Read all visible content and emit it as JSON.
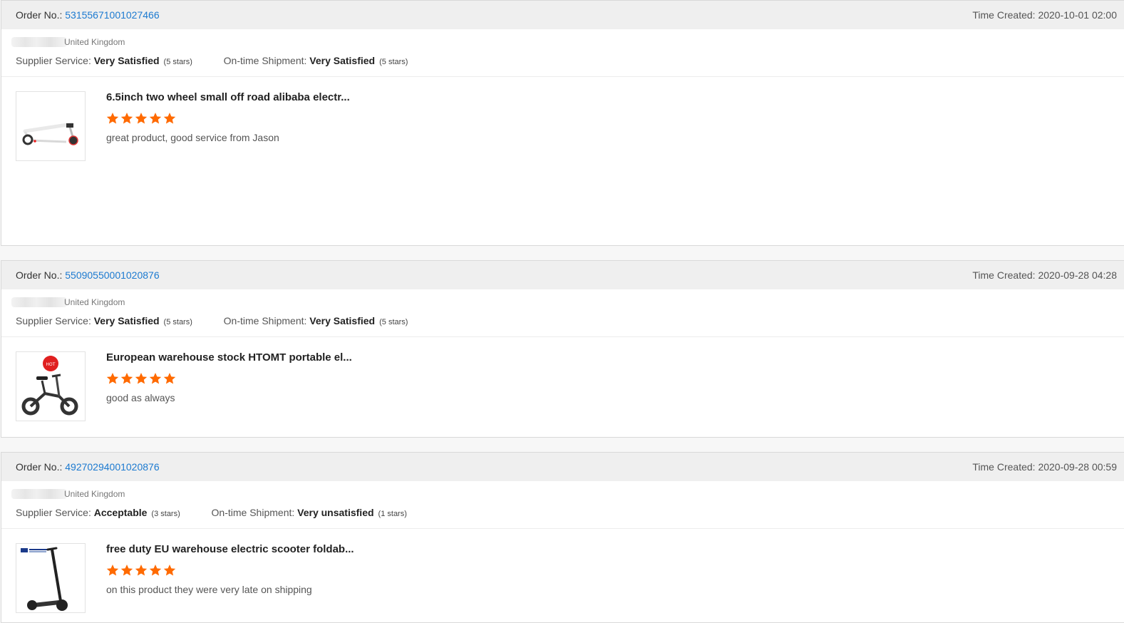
{
  "labels": {
    "order_no": "Order No.:",
    "time_created": "Time Created:",
    "supplier_service": "Supplier Service:",
    "ontime_shipment": "On-time Shipment:"
  },
  "colors": {
    "link": "#1c7ad0",
    "star": "#ff6a00",
    "header_bg": "#efefef"
  },
  "orders": [
    {
      "order_number": "53155671001027466",
      "time_created": "2020-10-01 02:00",
      "buyer_country": "United Kingdom",
      "supplier_service_value": "Very Satisfied",
      "supplier_service_stars": "(5 stars)",
      "shipment_value": "Very Satisfied",
      "shipment_stars": "(5 stars)",
      "product_title": "6.5inch two wheel small off road alibaba electr...",
      "product_rating": 5,
      "review": "great product, good service from Jason",
      "image_icon": "kick-scooter-icon"
    },
    {
      "order_number": "55090550001020876",
      "time_created": "2020-09-28 04:28",
      "buyer_country": "United Kingdom",
      "supplier_service_value": "Very Satisfied",
      "supplier_service_stars": "(5 stars)",
      "shipment_value": "Very Satisfied",
      "shipment_stars": "(5 stars)",
      "product_title": "European warehouse stock HTOMT portable el...",
      "product_rating": 5,
      "review": "good as always",
      "image_icon": "electric-bike-icon"
    },
    {
      "order_number": "49270294001020876",
      "time_created": "2020-09-28 00:59",
      "buyer_country": "United Kingdom",
      "supplier_service_value": "Acceptable",
      "supplier_service_stars": "(3 stars)",
      "shipment_value": "Very unsatisfied",
      "shipment_stars": "(1 stars)",
      "product_title": "free duty EU warehouse electric scooter foldab...",
      "product_rating": 5,
      "review": "on this product they were very late on shipping",
      "image_icon": "electric-scooter-icon"
    }
  ]
}
